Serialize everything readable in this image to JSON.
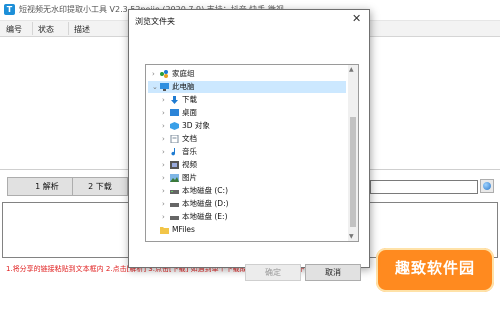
{
  "app": {
    "title": "短视频无水印提取小工具 V2.3   52pojie (2020.7.9)   支持：抖音 快手 微视",
    "icon": "app-logo-icon"
  },
  "list": {
    "columns": [
      "编号",
      "状态",
      "描述"
    ]
  },
  "buttons": {
    "parse": "1 解析",
    "download": "2 下载"
  },
  "status_text": "1.将分享的链接粘贴到文本框内  2.点击[解析]  3.点击[下载]  如遇到单个下载成功时,可尝试多次下载",
  "watermark": {
    "text": "趣致软件园",
    "color": "#ff8a1f"
  },
  "dialog": {
    "title": "浏览文件夹",
    "close": "✕",
    "tree": [
      {
        "label": "家庭组",
        "icon": "homegroup-icon",
        "arrow": "›",
        "selected": false
      },
      {
        "label": "此电脑",
        "icon": "this-pc-icon",
        "arrow": "⌄",
        "selected": true
      },
      {
        "label": "下载",
        "icon": "downloads-icon",
        "arrow": "›",
        "selected": false
      },
      {
        "label": "桌面",
        "icon": "desktop-icon",
        "arrow": "›",
        "selected": false
      },
      {
        "label": "3D 对象",
        "icon": "3d-objects-icon",
        "arrow": "›",
        "selected": false
      },
      {
        "label": "文档",
        "icon": "documents-icon",
        "arrow": "›",
        "selected": false
      },
      {
        "label": "音乐",
        "icon": "music-icon",
        "arrow": "›",
        "selected": false
      },
      {
        "label": "视频",
        "icon": "videos-icon",
        "arrow": "›",
        "selected": false
      },
      {
        "label": "图片",
        "icon": "pictures-icon",
        "arrow": "›",
        "selected": false
      },
      {
        "label": "本地磁盘 (C:)",
        "icon": "drive-icon",
        "arrow": "›",
        "selected": false
      },
      {
        "label": "本地磁盘 (D:)",
        "icon": "drive-icon",
        "arrow": "›",
        "selected": false
      },
      {
        "label": "本地磁盘 (E:)",
        "icon": "drive-icon",
        "arrow": "›",
        "selected": false
      },
      {
        "label": "MFiles",
        "icon": "folder-icon",
        "arrow": "",
        "selected": false
      }
    ],
    "ok": "确定",
    "cancel": "取消"
  }
}
